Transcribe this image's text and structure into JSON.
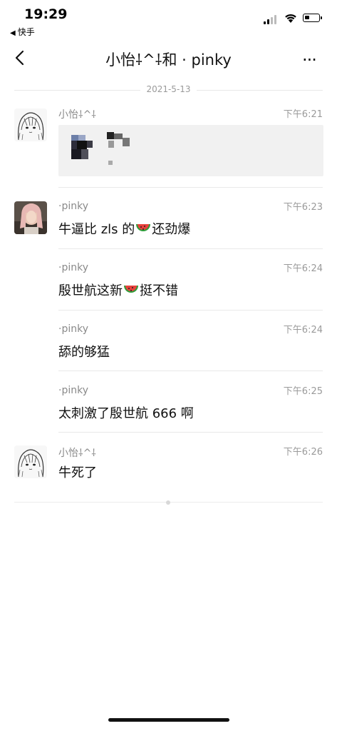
{
  "status_bar": {
    "time": "19:29",
    "back_app": "快手"
  },
  "nav": {
    "title": "小怡⸸^⸸和 · pinky",
    "more": "···"
  },
  "date_separator": "2021-5-13",
  "messages": [
    {
      "sender": "小怡⸸^⸸",
      "time": "下午6:21",
      "content": "",
      "type": "image"
    },
    {
      "sender": "·pinky",
      "time": "下午6:23",
      "text_before": "牛逼比 zls 的",
      "emoji": "watermelon",
      "text_after": "还劲爆"
    },
    {
      "sender": "·pinky",
      "time": "下午6:24",
      "text_before": "殷世航这新",
      "emoji": "watermelon",
      "text_after": "挺不错"
    },
    {
      "sender": "·pinky",
      "time": "下午6:24",
      "text": "舔的够猛"
    },
    {
      "sender": "·pinky",
      "time": "下午6:25",
      "text": "太刺激了殷世航 666 啊"
    },
    {
      "sender": "小怡⸸^⸸",
      "time": "下午6:26",
      "text": "牛死了"
    }
  ],
  "colors": {
    "background": "#ffffff",
    "meta_gray": "#9a9a9a",
    "divider": "#e9e9e9"
  }
}
